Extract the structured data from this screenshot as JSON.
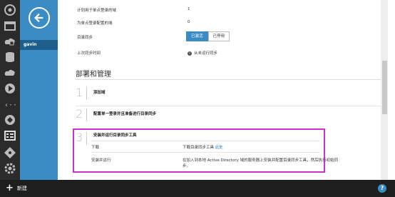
{
  "rail": {
    "icons": [
      "overview-icon",
      "web-icon",
      "cloud-service-icon",
      "sql-icon",
      "storage-icon",
      "media-icon",
      "network-icon",
      "traffic-icon",
      "active-directory-icon",
      "table-icon",
      "git-icon",
      "settings-icon"
    ]
  },
  "panel": {
    "user_item": "gavin"
  },
  "info": {
    "row1_label": "计划用于单点登录的域",
    "row1_value": "1",
    "row2_label": "为单点登录配置的域",
    "row2_value": "0",
    "row3_label": "目录同步",
    "toggle_on": "已激活",
    "toggle_off": "已停用",
    "row4_label": "上次同步时间",
    "row4_value": "从未运行同步"
  },
  "section": {
    "title": "部署和管理"
  },
  "steps": [
    {
      "num": "1",
      "title": "添加域"
    },
    {
      "num": "2",
      "title": "配置单一登录并且准备进行目录同步"
    },
    {
      "num": "3",
      "title": "安装并运行目录同步工具"
    }
  ],
  "step3": {
    "download_label": "下载",
    "download_text": "下载目录同步工具",
    "download_link": "此处",
    "install_label": "安装并运行",
    "install_text_line1": "在加入到本地 Active Directory 域的服务器上安装并配置目录同步工具，然后执行初始同",
    "install_text_line2": "步。"
  },
  "bottom": {
    "new_label": "新建",
    "help_label": "?"
  },
  "colors": {
    "accent": "#3b8cc4",
    "highlight": "#cc33cc",
    "rail": "#2b2b2b"
  }
}
